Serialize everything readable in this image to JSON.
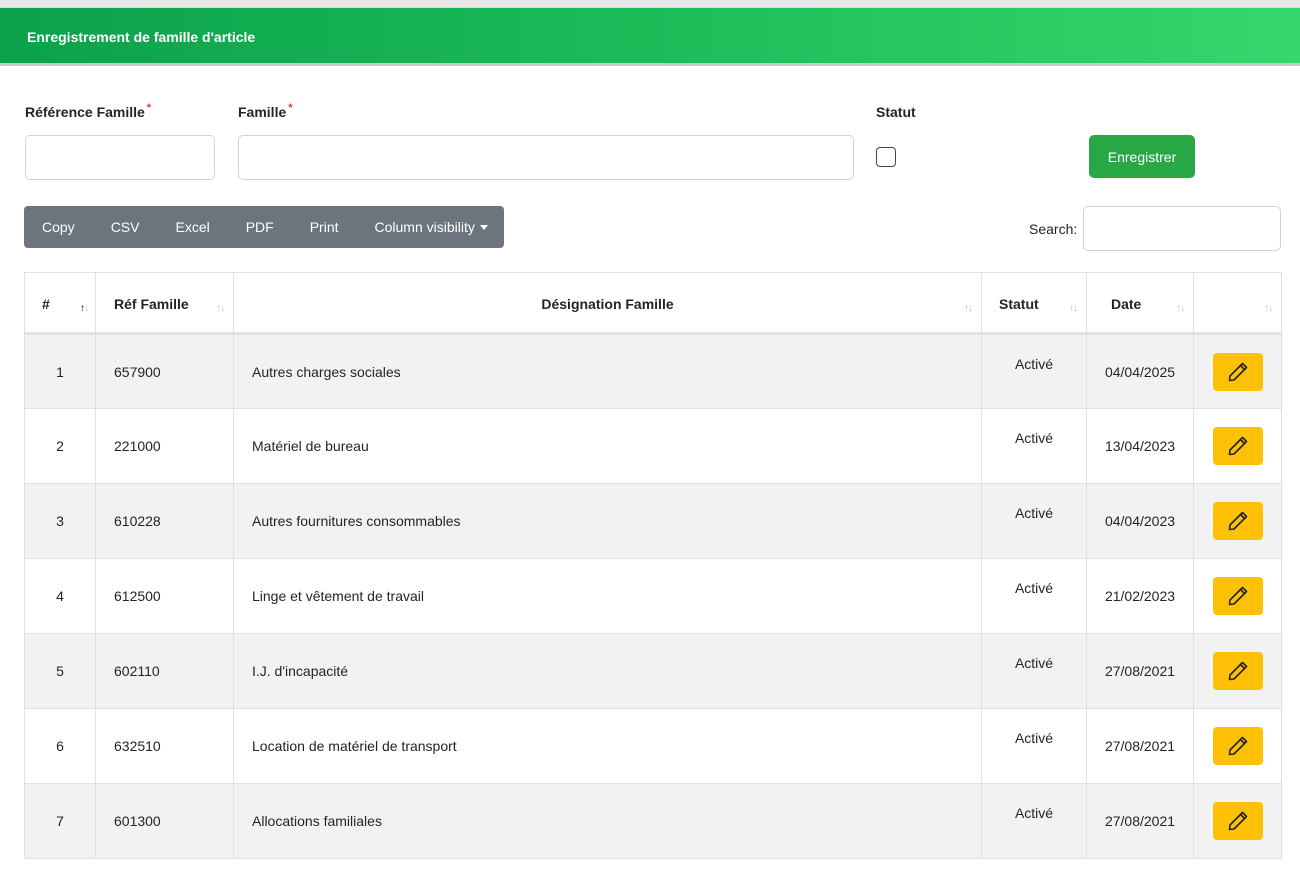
{
  "header": {
    "title": "Enregistrement de famille d'article"
  },
  "form": {
    "ref_label": "Référence Famille",
    "famille_label": "Famille",
    "required_mark": "*",
    "statut_label": "Statut",
    "ref_value": "",
    "famille_value": "",
    "statut_checked": false,
    "save_label": "Enregistrer"
  },
  "toolbar": {
    "buttons": [
      "Copy",
      "CSV",
      "Excel",
      "PDF",
      "Print",
      "Column visibility"
    ]
  },
  "search": {
    "label": "Search:",
    "value": ""
  },
  "table": {
    "columns": [
      "#",
      "Réf Famille",
      "Désignation Famille",
      "Statut",
      "Date",
      ""
    ],
    "rows": [
      {
        "num": "1",
        "ref": "657900",
        "designation": "Autres charges sociales",
        "statut": "Activé",
        "date": "04/04/2025"
      },
      {
        "num": "2",
        "ref": "221000",
        "designation": "Matériel de bureau",
        "statut": "Activé",
        "date": "13/04/2023"
      },
      {
        "num": "3",
        "ref": "610228",
        "designation": "Autres fournitures consommables",
        "statut": "Activé",
        "date": "04/04/2023"
      },
      {
        "num": "4",
        "ref": "612500",
        "designation": "Linge et vêtement de travail",
        "statut": "Activé",
        "date": "21/02/2023"
      },
      {
        "num": "5",
        "ref": "602110",
        "designation": "I.J. d'incapacité",
        "statut": "Activé",
        "date": "27/08/2021"
      },
      {
        "num": "6",
        "ref": "632510",
        "designation": "Location de matériel de transport",
        "statut": "Activé",
        "date": "27/08/2021"
      },
      {
        "num": "7",
        "ref": "601300",
        "designation": "Allocations familiales",
        "statut": "Activé",
        "date": "27/08/2021"
      }
    ]
  },
  "colors": {
    "header_start": "#0aa14b",
    "header_end": "#36d76d",
    "save_button": "#28a745",
    "toolbar": "#6c757d",
    "edit_button": "#ffc107"
  },
  "icons": {
    "edit": "pencil-icon",
    "sort": "sort-icon"
  }
}
